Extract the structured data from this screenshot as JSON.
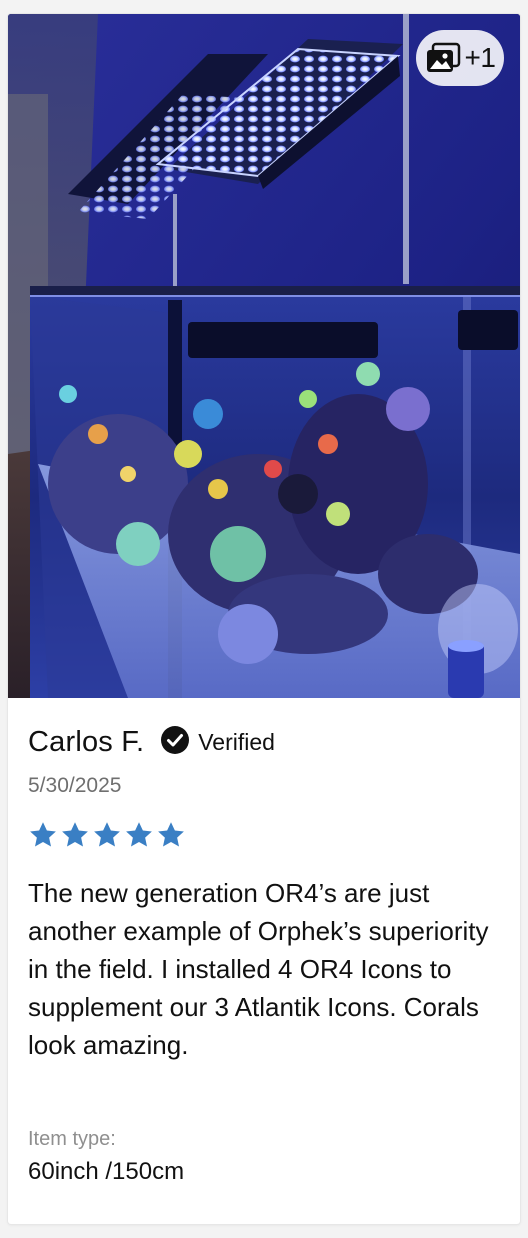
{
  "review": {
    "author": "Carlos F.",
    "verified_label": "Verified",
    "date": "5/30/2025",
    "rating": 5,
    "rating_max": 5,
    "text": "The new generation OR4’s are just another example of Orphek’s superiority in the field. I installed 4 OR4 Icons to supplement our 3 Atlantik Icons. Corals look amazing.",
    "item_type_label": "Item type:",
    "item_type_value": "60inch /150cm"
  },
  "media": {
    "extra_count": "+1",
    "icon": "gallery-icon"
  },
  "colors": {
    "star": "#3a7fc4",
    "verified_badge": "#111111",
    "date_text": "#6f6f6f",
    "label_text": "#8f8f8f"
  }
}
